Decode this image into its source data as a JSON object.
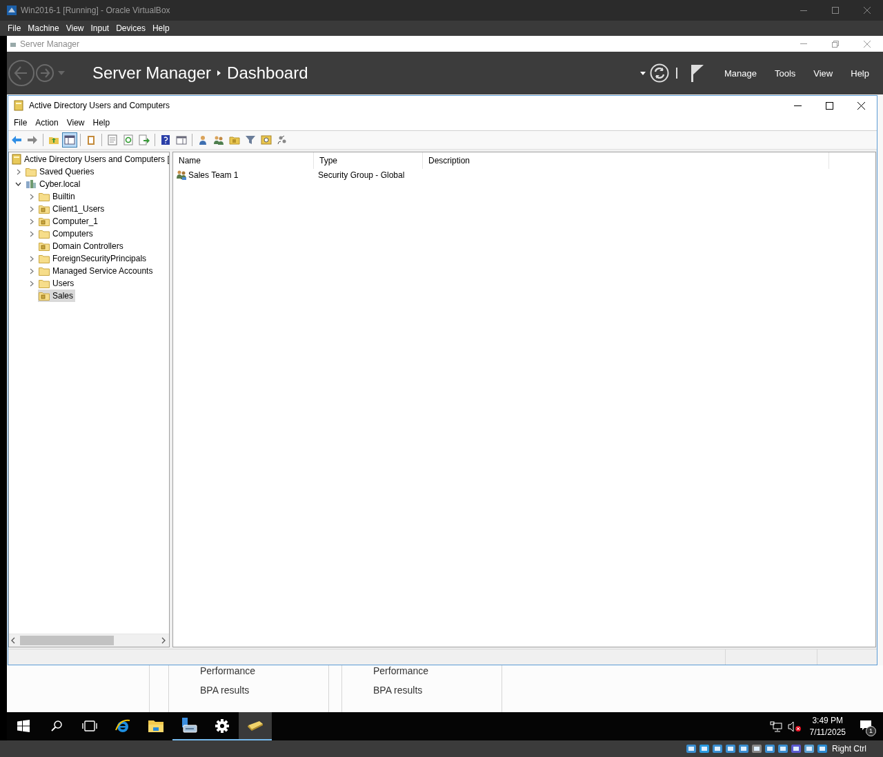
{
  "vbox": {
    "title": "Win2016-1 [Running] - Oracle VirtualBox",
    "menu": [
      "File",
      "Machine",
      "View",
      "Input",
      "Devices",
      "Help"
    ],
    "host_key": "Right Ctrl"
  },
  "server_manager": {
    "title": "Server Manager",
    "breadcrumb": [
      "Server Manager",
      "Dashboard"
    ],
    "menu": [
      "Manage",
      "Tools",
      "View",
      "Help"
    ],
    "tiles": [
      {
        "lines": [
          "Performance",
          "BPA results"
        ]
      },
      {
        "lines": [
          "Performance",
          "BPA results"
        ]
      }
    ]
  },
  "aduc": {
    "title": "Active Directory Users and Computers",
    "menu": [
      "File",
      "Action",
      "View",
      "Help"
    ],
    "toolbar": [
      {
        "kind": "back",
        "pressed": false
      },
      {
        "kind": "forward",
        "pressed": false
      },
      {
        "kind": "separator"
      },
      {
        "kind": "up",
        "pressed": false
      },
      {
        "kind": "console-tree",
        "pressed": true
      },
      {
        "kind": "separator"
      },
      {
        "kind": "clipboard",
        "pressed": false
      },
      {
        "kind": "separator"
      },
      {
        "kind": "properties",
        "pressed": false
      },
      {
        "kind": "refresh",
        "pressed": false
      },
      {
        "kind": "export",
        "pressed": false
      },
      {
        "kind": "separator"
      },
      {
        "kind": "help",
        "pressed": false
      },
      {
        "kind": "pane",
        "pressed": false
      },
      {
        "kind": "separator"
      },
      {
        "kind": "user",
        "pressed": false
      },
      {
        "kind": "group",
        "pressed": false
      },
      {
        "kind": "ou",
        "pressed": false
      },
      {
        "kind": "filter",
        "pressed": false
      },
      {
        "kind": "find",
        "pressed": false
      },
      {
        "kind": "delegate",
        "pressed": false
      }
    ],
    "tree": [
      {
        "label": "Active Directory Users and Computers [",
        "kind": "root",
        "selected": false,
        "children": [
          {
            "label": "Saved Queries",
            "kind": "folder",
            "expanded": false,
            "selected": false
          },
          {
            "label": "Cyber.local",
            "kind": "domain",
            "expanded": true,
            "selected": false,
            "children": [
              {
                "label": "Builtin",
                "kind": "folder",
                "expanded": false,
                "selected": false
              },
              {
                "label": "Client1_Users",
                "kind": "ou",
                "expanded": false,
                "selected": false
              },
              {
                "label": "Computer_1",
                "kind": "ou",
                "expanded": false,
                "selected": false
              },
              {
                "label": "Computers",
                "kind": "folder",
                "expanded": false,
                "selected": false
              },
              {
                "label": "Domain Controllers",
                "kind": "ou",
                "selected": false
              },
              {
                "label": "ForeignSecurityPrincipals",
                "kind": "folder",
                "expanded": false,
                "selected": false
              },
              {
                "label": "Managed Service Accounts",
                "kind": "folder",
                "expanded": false,
                "selected": false
              },
              {
                "label": "Users",
                "kind": "folder",
                "expanded": false,
                "selected": false
              },
              {
                "label": "Sales",
                "kind": "ou",
                "selected": true
              }
            ]
          }
        ]
      }
    ],
    "columns": [
      "Name",
      "Type",
      "Description"
    ],
    "rows": [
      {
        "name": "Sales Team 1",
        "type": "Security Group - Global",
        "selected": false
      }
    ]
  },
  "taskbar": {
    "apps": [
      {
        "kind": "start",
        "running": false,
        "selected": false
      },
      {
        "kind": "search",
        "running": false,
        "selected": false
      },
      {
        "kind": "task-view",
        "running": false,
        "selected": false
      },
      {
        "kind": "browser",
        "running": false,
        "selected": false
      },
      {
        "kind": "explorer",
        "running": false,
        "selected": false
      },
      {
        "kind": "server-manager",
        "running": true,
        "selected": false
      },
      {
        "kind": "settings",
        "running": true,
        "selected": false
      },
      {
        "kind": "directory",
        "running": true,
        "selected": true
      }
    ],
    "time": "3:49 PM",
    "date": "7/11/2025",
    "notifications": "1"
  }
}
